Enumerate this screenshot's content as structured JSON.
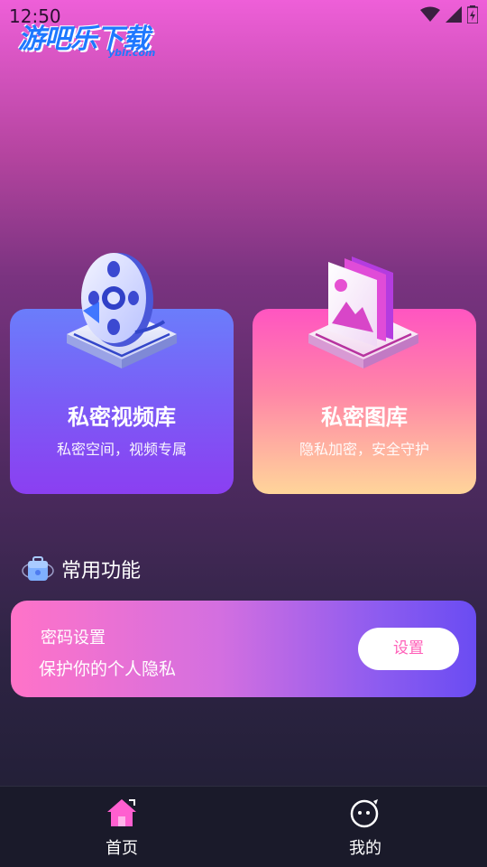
{
  "status_bar": {
    "time": "12:50"
  },
  "watermark": {
    "text": "游吧乐下载",
    "url": "yblr.com"
  },
  "cards": [
    {
      "title": "私密视频库",
      "subtitle": "私密空间，视频专属",
      "icon": "film-reel-icon"
    },
    {
      "title": "私密图库",
      "subtitle": "隐私加密，安全守护",
      "icon": "photo-stack-icon"
    }
  ],
  "section": {
    "title": "常用功能",
    "icon": "toolbox-icon"
  },
  "password_card": {
    "title": "密码设置",
    "description": "保护你的个人隐私",
    "button_label": "设置"
  },
  "bottom_nav": {
    "items": [
      {
        "label": "首页",
        "icon": "home-icon",
        "active": true,
        "color": "#ff5fd0"
      },
      {
        "label": "我的",
        "icon": "face-icon",
        "active": false
      }
    ]
  }
}
